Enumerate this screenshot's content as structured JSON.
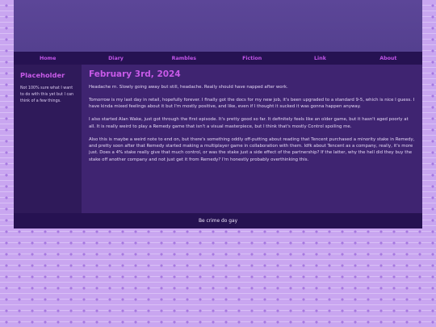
{
  "nav": {
    "items": [
      {
        "label": "Home"
      },
      {
        "label": "Diary"
      },
      {
        "label": "Rambles"
      },
      {
        "label": "Fiction"
      },
      {
        "label": "Link"
      },
      {
        "label": "About"
      }
    ]
  },
  "sidebar": {
    "title": "Placeholder",
    "text": "Not 100% sure what I want to do with this yet but I can think of a few things."
  },
  "entry": {
    "date": "February 3rd, 2024",
    "paragraphs": [
      "Headache rn. Slowly going away but still, headache. Really should have napped after work.",
      "Tomorrow is my last day in retail, hopefully forever. I finally got the docs for my new job, it's been upgraded to a standard 9-5, which is nice I guess. I have kinda mixed feelings about it but I'm mostly positive, and like, even if I thought it sucked it was gonna happen anyway.",
      "I also started Alan Wake, just got through the first episode. It's pretty good so far. It definitely feels like an older game, but it hasn't aged poorly at all. It is really weird to play a Remedy game that isn't a visual masterpiece, but I think that's mostly Control spoiling me.",
      "Also this is maybe a weird note to end on, but there's something oddly off-putting about reading that Tencent purchased a minority stake in Remedy, and pretty soon after that Remedy started making a multiplayer game in collaboration with them. Idfk about Tencent as a company, really, it's more just. Does a 4% stake really give that much control, or was the stake just a side effect of the partnership? If the latter, why the hell did they buy the stake off another company and not just get it from Remedy? I'm honestly probably overthinking this."
    ]
  },
  "footer": {
    "text": "Be crime do gay"
  }
}
